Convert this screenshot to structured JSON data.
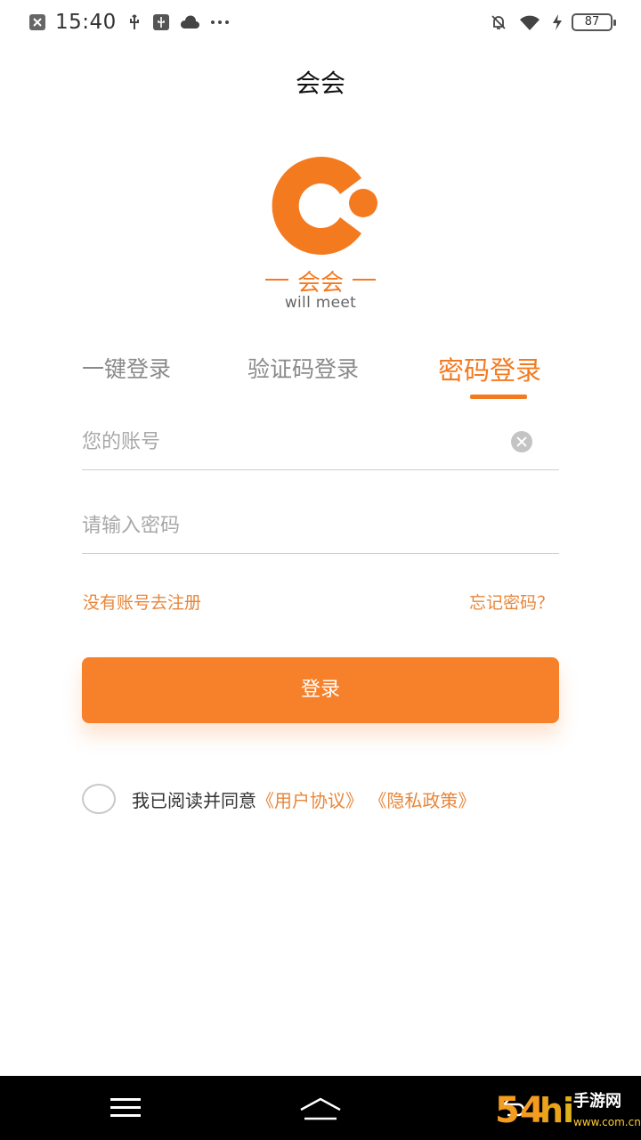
{
  "status_bar": {
    "time": "15:40",
    "battery": "87",
    "icons": [
      "close-notification-icon",
      "usb-icon",
      "usb-debug-icon",
      "cloud-icon",
      "more-dots-icon",
      "mute-bell-icon",
      "wifi-icon",
      "charging-icon",
      "battery-icon"
    ]
  },
  "header": {
    "title": "会会"
  },
  "logo": {
    "name": "会会",
    "tagline": "will meet",
    "color": "#f47a20"
  },
  "tabs": [
    {
      "label": "一键登录",
      "active": false
    },
    {
      "label": "验证码登录",
      "active": false
    },
    {
      "label": "密码登录",
      "active": true
    }
  ],
  "form": {
    "account_placeholder": "您的账号",
    "password_placeholder": "请输入密码"
  },
  "links": {
    "register": "没有账号去注册",
    "forgot": "忘记密码？"
  },
  "login_button": {
    "label": "登录",
    "color": "#f6812a"
  },
  "agreement": {
    "prefix": "我已阅读并同意",
    "user_agreement": "《用户协议》",
    "privacy_policy": "《隐私政策》",
    "checked": false
  },
  "watermark": {
    "text": "54hi手游网",
    "domain": "www.com.cn"
  },
  "colors": {
    "accent": "#f47a20",
    "link": "#e8863a",
    "navbar": "#000000"
  }
}
